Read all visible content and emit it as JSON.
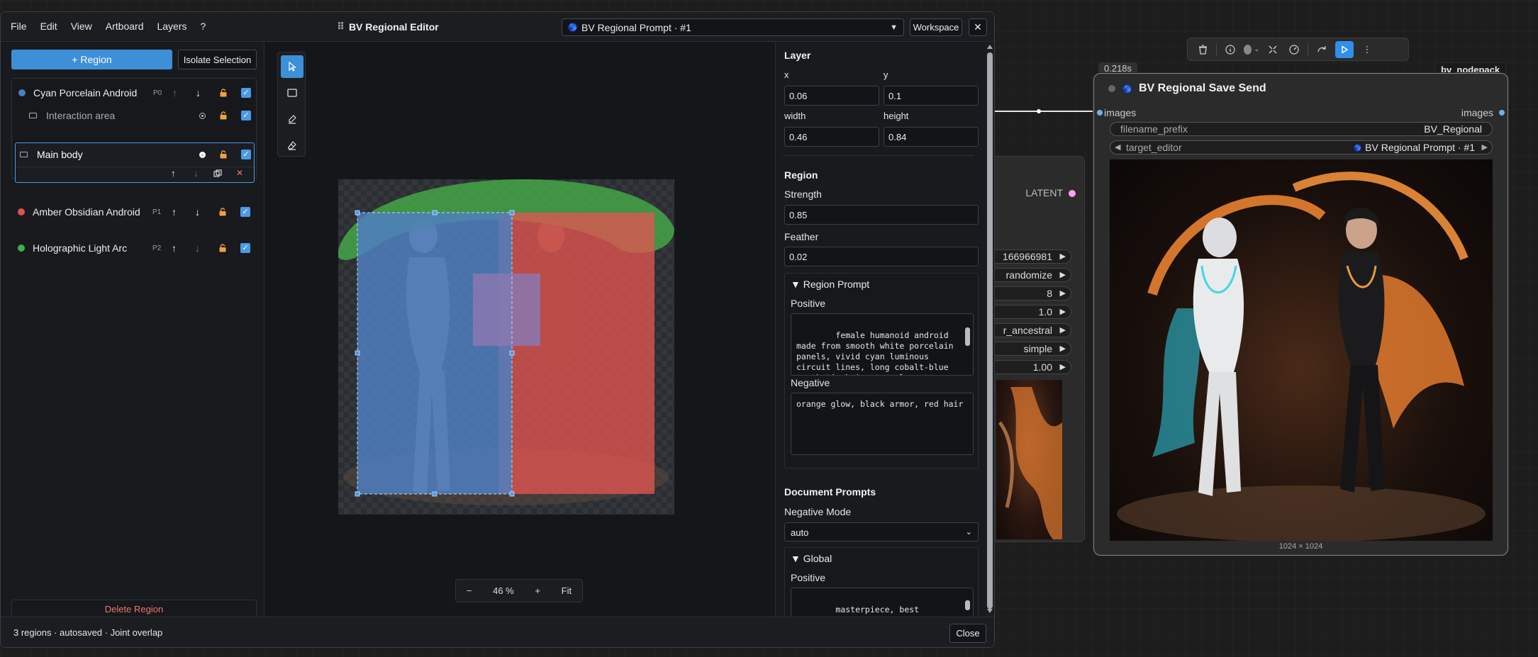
{
  "editor": {
    "menu": [
      "File",
      "Edit",
      "View",
      "Artboard",
      "Layers",
      "?"
    ],
    "title": "BV Regional Editor",
    "target_select": "BV Regional Prompt · #1",
    "workspace_label": "Workspace",
    "close_x": "✕",
    "footer_status": "3 regions · autosaved · Joint overlap",
    "close_label": "Close"
  },
  "left": {
    "add_region_label": "+ Region",
    "isolate_label": "Isolate Selection",
    "delete_label": "Delete Region",
    "regions": [
      {
        "name": "Cyan Porcelain Android",
        "priority": "P0",
        "color": "#4a7fc1"
      },
      {
        "name": "Amber Obsidian Android",
        "priority": "P1",
        "color": "#e0524d"
      },
      {
        "name": "Holographic Light Arc",
        "priority": "P2",
        "color": "#3fae4e"
      }
    ],
    "sub_layers": [
      {
        "name": "Interaction area"
      },
      {
        "name": "Main body"
      }
    ],
    "tools": [
      "select-tool",
      "rectangle-tool",
      "brush-tool",
      "eraser-tool"
    ]
  },
  "canvas": {
    "zoom_minus": "−",
    "zoom_value": "46 %",
    "zoom_plus": "+",
    "fit_label": "Fit"
  },
  "inspector": {
    "layer_heading": "Layer",
    "x_label": "x",
    "x_value": "0.06",
    "y_label": "y",
    "y_value": "0.1",
    "width_label": "width",
    "width_value": "0.46",
    "height_label": "height",
    "height_value": "0.84",
    "region_heading": "Region",
    "strength_label": "Strength",
    "strength_value": "0.85",
    "feather_label": "Feather",
    "feather_value": "0.02",
    "region_prompt_heading": "▼ Region Prompt",
    "positive_label": "Positive",
    "positive_text": "female humanoid android made from smooth white porcelain panels, vivid cyan luminous circuit lines, long cobalt-blue synthetic hair, translucent cyan fabric",
    "negative_label": "Negative",
    "negative_text": "orange glow, black armor, red hair",
    "doc_prompts_heading": "Document Prompts",
    "negative_mode_label": "Negative Mode",
    "negative_mode_value": "auto",
    "global_heading": "▼ Global",
    "global_positive_label": "Positive",
    "global_positive_text": "masterpiece, best quality, exactly two female humanoid"
  },
  "graph": {
    "latent_label": "LATENT",
    "bg_widgets": [
      "166966981",
      "randomize",
      "8",
      "1.0",
      "r_ancestral",
      "simple",
      "1.00"
    ],
    "toolbar_icons": [
      "trash-icon",
      "info-icon",
      "color-icon",
      "bypass-icon",
      "speed-icon",
      "redo-icon",
      "run-icon",
      "more-icon"
    ],
    "save_node": {
      "time": "0.218s",
      "badge": "bv_nodepack",
      "title": "BV Regional Save Send",
      "input_label": "images",
      "output_label": "images",
      "filename_label": "filename_prefix",
      "filename_value": "BV_Regional",
      "target_label": "target_editor",
      "target_value": "BV Regional Prompt · #1",
      "size_label": "1024 × 1024"
    }
  }
}
